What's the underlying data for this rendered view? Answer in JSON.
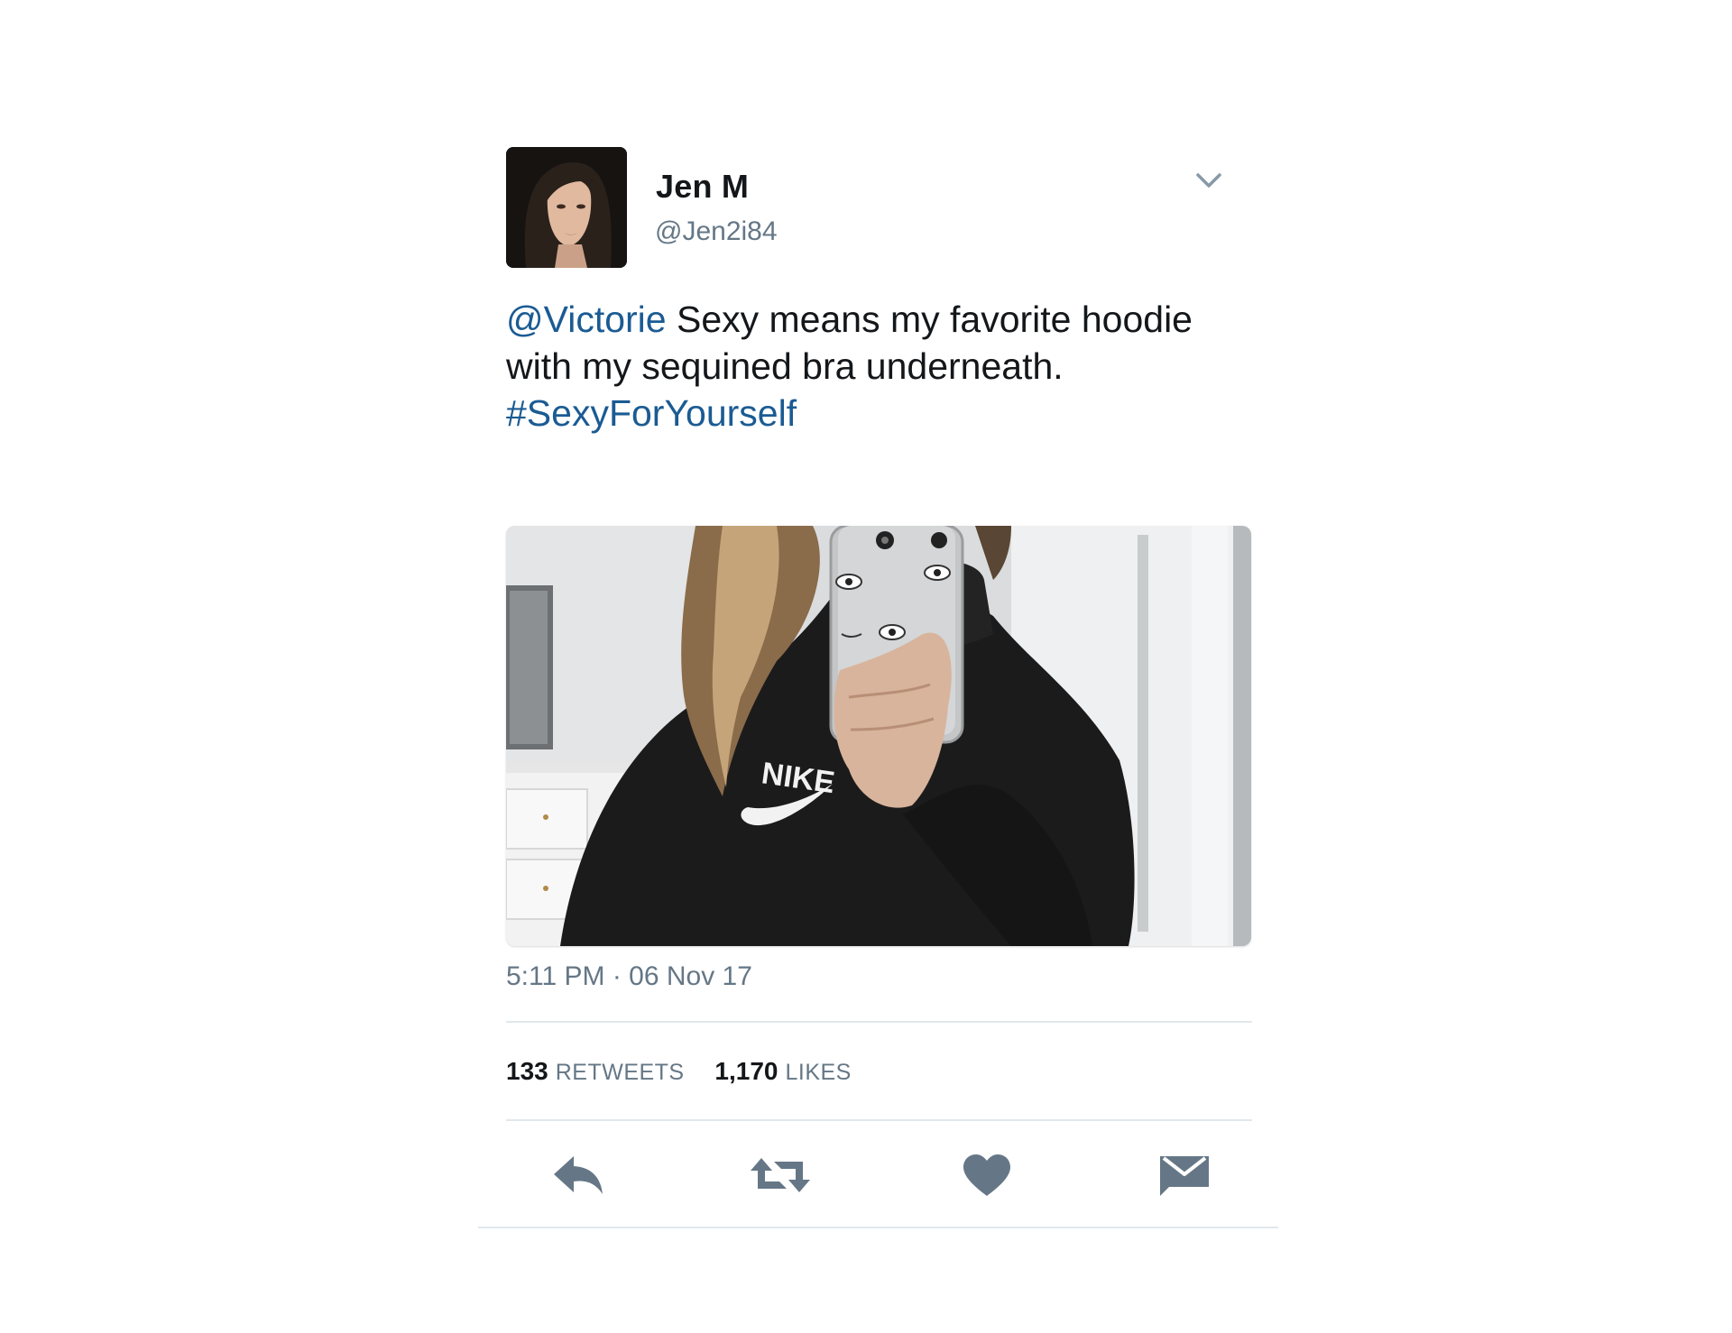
{
  "tweet": {
    "author": {
      "display_name": "Jen M",
      "handle": "@Jen2i84"
    },
    "text": {
      "mention": "@Victorie",
      "body": " Sexy means my favorite hoodie with my sequined bra underneath. ",
      "hashtag": "#SexyForYourself"
    },
    "timestamp": "5:11 PM · 06 Nov 17",
    "stats": {
      "retweets_count": "133",
      "retweets_label": "RETWEETS",
      "likes_count": "1,170",
      "likes_label": "LIKES"
    },
    "actions": [
      {
        "name": "reply",
        "icon": "reply-icon"
      },
      {
        "name": "retweet",
        "icon": "retweet-icon"
      },
      {
        "name": "like",
        "icon": "heart-icon"
      },
      {
        "name": "direct-message",
        "icon": "envelope-icon"
      }
    ],
    "media_logo_text": "NIKE"
  },
  "colors": {
    "link": "#1b5b93",
    "secondary_text": "#657786",
    "icon": "#657786",
    "divider": "#e1e8ed"
  }
}
